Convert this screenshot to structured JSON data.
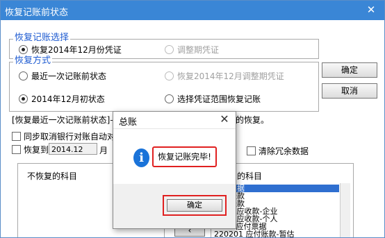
{
  "window": {
    "title": "恢复记账前状态",
    "close_symbol": "✕"
  },
  "group_select": {
    "legend": "恢复记账选择",
    "options": [
      {
        "label": "恢复2014年12月份凭证",
        "checked": true,
        "disabled": false
      },
      {
        "label": "调整期凭证",
        "checked": false,
        "disabled": true
      }
    ]
  },
  "group_method": {
    "legend": "恢复方式",
    "options": [
      {
        "label": "最近一次记账前状态",
        "checked": false,
        "disabled": false
      },
      {
        "label": "恢复2014年12月调整期凭证",
        "checked": false,
        "disabled": true
      },
      {
        "label": "2014年12月初状态",
        "checked": true,
        "disabled": false
      },
      {
        "label": "选择凭证范围恢复记账",
        "checked": false,
        "disabled": false
      }
    ]
  },
  "buttons": {
    "ok": "确定",
    "cancel": "取消"
  },
  "info_text": {
    "left": "[恢复最近一次记账前状态]—",
    "right": "的恢复。"
  },
  "options": {
    "sync_cancel": "同步取消银行对账自动对",
    "restore_to_label": "恢复到",
    "restore_to_value": "2014.12",
    "month_suffix": "月",
    "clear_redundant": "清除冗余数据"
  },
  "left_panel": {
    "header": "不恢复的科目"
  },
  "right_panel": {
    "header": "的科目",
    "items": [
      {
        "text": "应收票据",
        "selected": true
      },
      {
        "text": "应收账款",
        "selected": false
      },
      {
        "text": "预付账款",
        "selected": false
      },
      {
        "text": "1  其他应收款-企业",
        "selected": false
      },
      {
        "text": "2  其他应收款-个人",
        "selected": false
      },
      {
        "text": "2201  应付票据",
        "selected": false
      },
      {
        "text": "220201  应付账款-暂估",
        "selected": false
      }
    ]
  },
  "dialog": {
    "title": "总账",
    "close_symbol": "✕",
    "icon_letter": "i",
    "message": "恢复记账完毕!",
    "ok": "确定"
  }
}
